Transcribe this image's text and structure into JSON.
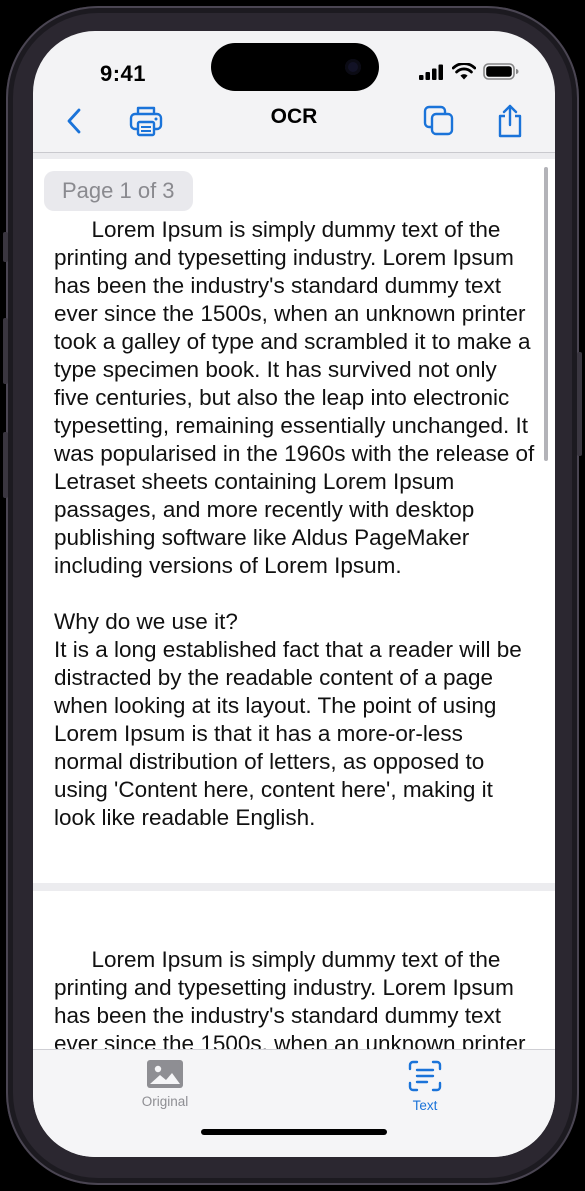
{
  "status_bar": {
    "time": "9:41"
  },
  "nav": {
    "title": "OCR",
    "back_icon": "chevron-left-icon",
    "print_icon": "printer-icon",
    "copy_icon": "copy-icon",
    "share_icon": "share-icon"
  },
  "page_badge": "Page 1 of 3",
  "pages": [
    {
      "text": "Lorem Ipsum is simply dummy text of the printing and typesetting industry. Lorem Ipsum has been the industry's standard dummy text ever since the 1500s, when an unknown printer took a galley of type and scrambled it to make a type specimen book. It has survived not only five centuries, but also the leap into electronic typesetting, remaining essentially unchanged. It was popularised in the 1960s with the release of Letraset sheets containing Lorem Ipsum passages, and more recently with desktop publishing software like Aldus PageMaker including versions of Lorem Ipsum.\n\nWhy do we use it?\nIt is a long established fact that a reader will be distracted by the readable content of a page when looking at its layout. The point of using Lorem Ipsum is that it has a more-or-less normal distribution of letters, as opposed to using 'Content here, content here', making it look like readable English."
    },
    {
      "text": "Lorem Ipsum is simply dummy text of the printing and typesetting industry. Lorem Ipsum has been the industry's standard dummy text ever since the 1500s, when an unknown printer took a galley of type and scrambled it to make a type specimen book."
    }
  ],
  "tabs": [
    {
      "label": "Original",
      "icon": "photo-icon",
      "selected": false
    },
    {
      "label": "Text",
      "icon": "text-scan-icon",
      "selected": true
    }
  ],
  "colors": {
    "accent": "#1a73d9",
    "inactive": "#8e8e93"
  }
}
